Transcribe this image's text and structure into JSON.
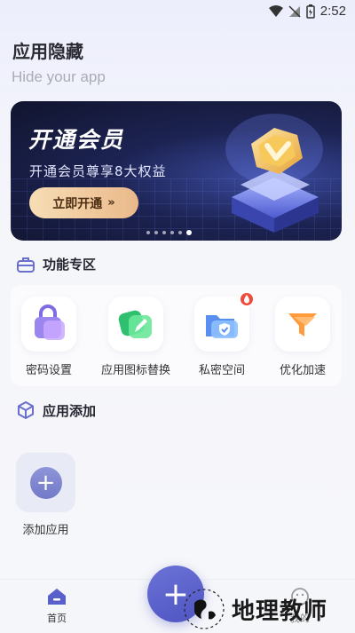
{
  "status_bar": {
    "time": "2:52"
  },
  "header": {
    "title": "应用隐藏",
    "subtitle": "Hide your app"
  },
  "banner": {
    "title": "开通会员",
    "subtitle": "开通会员尊享8大权益",
    "button_label": "立即开通",
    "button_arrow": "»",
    "dot_count": 6,
    "active_dot": 5
  },
  "features": {
    "section_title": "功能专区",
    "items": [
      {
        "label": "密码设置",
        "icon": "lock-icon"
      },
      {
        "label": "应用图标替换",
        "icon": "edit-icon"
      },
      {
        "label": "私密空间",
        "icon": "shield-folder-icon",
        "badge": "hot"
      },
      {
        "label": "优化加速",
        "icon": "funnel-icon"
      }
    ]
  },
  "app_add": {
    "section_title": "应用添加",
    "add_label": "添加应用"
  },
  "bottom_nav": {
    "home_label": "首页",
    "mine_label": "我的",
    "fab_label": "+"
  },
  "watermark": {
    "text": "地理教师"
  },
  "colors": {
    "accent": "#5a60c9",
    "banner_bg": "#1c2352",
    "button_gold": "#f7ddb5"
  }
}
